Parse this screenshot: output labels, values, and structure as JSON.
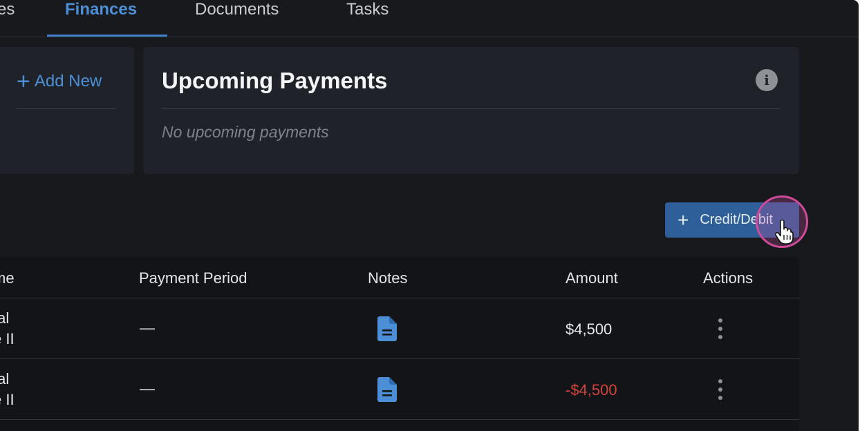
{
  "tabs": [
    {
      "label": "es",
      "active": false
    },
    {
      "label": "Finances",
      "active": true
    },
    {
      "label": "Documents",
      "active": false
    },
    {
      "label": "Tasks",
      "active": false
    }
  ],
  "left_card": {
    "add_new_label": "Add New",
    "add_icon": "plus-icon"
  },
  "upcoming_payments": {
    "title": "Upcoming Payments",
    "info_icon": "info-icon",
    "empty_text": "No upcoming payments"
  },
  "toolbar": {
    "credit_debit_label": "Credit/Debit",
    "cursor_icon": "hand-pointer-icon"
  },
  "table": {
    "headers": [
      "me",
      "Payment Period",
      "Notes",
      "Amount",
      "Actions"
    ],
    "rows": [
      {
        "name_line1": "tal",
        "name_line2": "e II",
        "period": "—",
        "notes_icon": "document-icon",
        "amount": "$4,500",
        "actions_icon": "kebab-menu-icon"
      },
      {
        "name_line1": "tal",
        "name_line2": "e II",
        "period": "—",
        "notes_icon": "document-icon",
        "amount": "-$4,500",
        "actions_icon": "kebab-menu-icon"
      }
    ]
  },
  "colors": {
    "accent": "#4d8fd6",
    "button": "#2f5f98",
    "negative": "#d2453b",
    "background": "#17191d",
    "card": "#1f2329"
  }
}
